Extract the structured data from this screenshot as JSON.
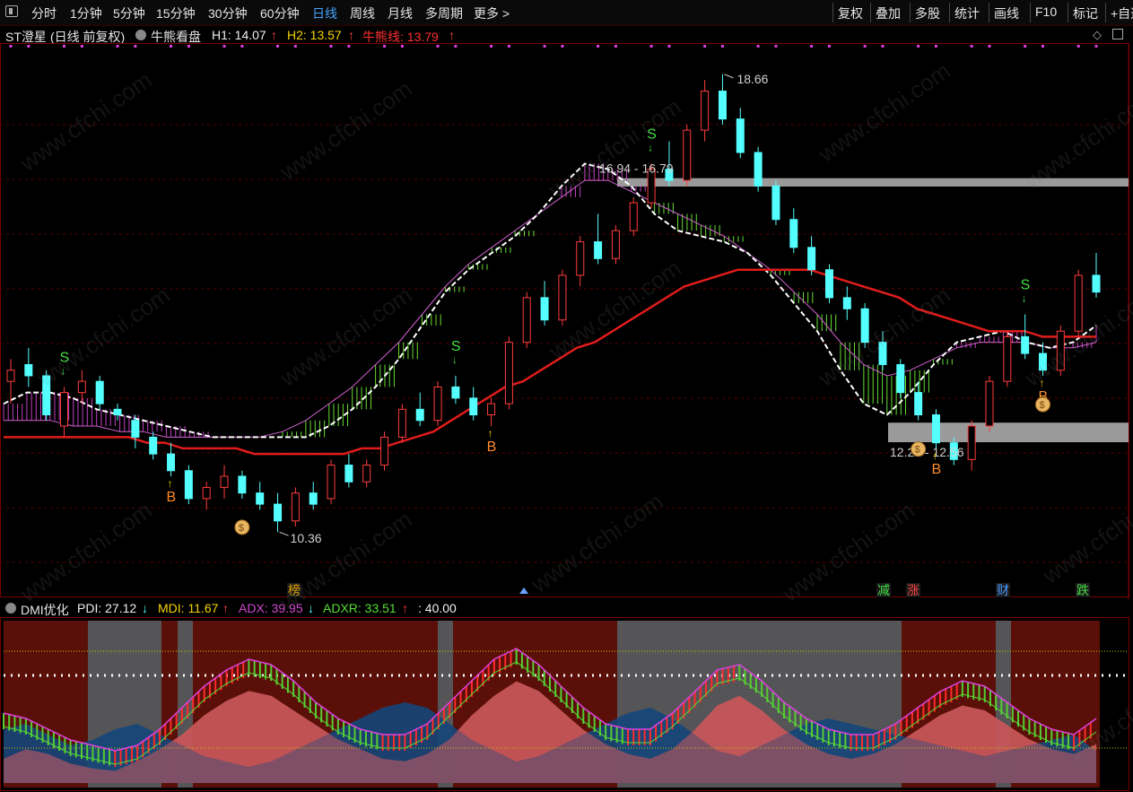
{
  "toolbar": {
    "left": [
      "分时",
      "1分钟",
      "5分钟",
      "15分钟",
      "30分钟",
      "60分钟",
      "日线",
      "周线",
      "月线",
      "多周期",
      "更多 >"
    ],
    "active": "日线",
    "right": [
      "复权",
      "叠加",
      "多股",
      "统计",
      "画线",
      "F10",
      "标记",
      "+自选"
    ]
  },
  "info": {
    "stock": "ST澄星",
    "mode": "(日线 前复权)",
    "indicator": "牛熊看盘",
    "h1_label": "H1: 14.07",
    "h2_label": "H2: 13.57",
    "bear_label": "牛熊线: 13.79",
    "up_arrow": "↑"
  },
  "labels": {
    "high": "18.66",
    "low": "10.36",
    "zone_top": "16.94 - 16.79",
    "zone_bottom": "12.21 - 12.56"
  },
  "events": [
    "榜",
    "减",
    "涨",
    "财",
    "跌"
  ],
  "dmi": {
    "name": "DMI优化",
    "pdi": "PDI: 27.12",
    "mdi": "MDI: 11.67",
    "adx": "ADX: 39.95",
    "adxr": "ADXR: 33.51",
    "level": ": 40.00",
    "down": "↓",
    "up": "↑"
  },
  "watermark": "www.cfchi.com",
  "colors": {
    "up": "#ff3c3c",
    "down": "#54ffff",
    "ma": "#e01c1c",
    "bull_band": "#c040c0",
    "bear_band": "#66dd33",
    "zone": "#9a9a9a",
    "active_tab": "#46a5ff"
  },
  "chart_data": {
    "type": "candlestick",
    "ylim": [
      9.8,
      19.2
    ],
    "candles": [
      [
        13.3,
        13.7,
        12.9,
        13.5
      ],
      [
        13.6,
        13.9,
        13.2,
        13.4
      ],
      [
        13.4,
        13.5,
        12.6,
        12.7
      ],
      [
        12.5,
        13.2,
        12.3,
        13.1
      ],
      [
        13.1,
        13.5,
        12.9,
        13.3
      ],
      [
        13.3,
        13.4,
        12.8,
        12.9
      ],
      [
        12.8,
        12.9,
        12.6,
        12.7
      ],
      [
        12.6,
        12.7,
        12.1,
        12.3
      ],
      [
        12.3,
        12.4,
        11.9,
        12.0
      ],
      [
        12.0,
        12.2,
        11.6,
        11.7
      ],
      [
        11.7,
        11.8,
        11.1,
        11.2
      ],
      [
        11.2,
        11.5,
        11.0,
        11.4
      ],
      [
        11.4,
        11.8,
        11.2,
        11.6
      ],
      [
        11.6,
        11.7,
        11.2,
        11.3
      ],
      [
        11.3,
        11.5,
        11.0,
        11.1
      ],
      [
        11.1,
        11.3,
        10.6,
        10.8
      ],
      [
        10.8,
        11.4,
        10.7,
        11.3
      ],
      [
        11.3,
        11.5,
        11.0,
        11.1
      ],
      [
        11.2,
        11.9,
        11.1,
        11.8
      ],
      [
        11.8,
        12.0,
        11.4,
        11.5
      ],
      [
        11.5,
        11.9,
        11.4,
        11.8
      ],
      [
        11.8,
        12.4,
        11.7,
        12.3
      ],
      [
        12.3,
        12.9,
        12.2,
        12.8
      ],
      [
        12.8,
        13.1,
        12.5,
        12.6
      ],
      [
        12.6,
        13.3,
        12.5,
        13.2
      ],
      [
        13.2,
        13.4,
        12.9,
        13.0
      ],
      [
        13.0,
        13.2,
        12.6,
        12.7
      ],
      [
        12.7,
        13.0,
        12.5,
        12.9
      ],
      [
        12.9,
        14.1,
        12.8,
        14.0
      ],
      [
        14.0,
        14.9,
        13.9,
        14.8
      ],
      [
        14.8,
        15.1,
        14.3,
        14.4
      ],
      [
        14.4,
        15.3,
        14.3,
        15.2
      ],
      [
        15.2,
        15.9,
        15.0,
        15.8
      ],
      [
        15.8,
        16.3,
        15.4,
        15.5
      ],
      [
        15.5,
        16.1,
        15.4,
        16.0
      ],
      [
        16.0,
        16.6,
        15.9,
        16.5
      ],
      [
        16.5,
        17.2,
        16.4,
        17.1
      ],
      [
        17.1,
        17.6,
        16.8,
        16.9
      ],
      [
        16.9,
        17.9,
        16.8,
        17.8
      ],
      [
        17.8,
        18.7,
        17.6,
        18.5
      ],
      [
        18.5,
        18.8,
        17.9,
        18.0
      ],
      [
        18.0,
        18.2,
        17.3,
        17.4
      ],
      [
        17.4,
        17.5,
        16.7,
        16.8
      ],
      [
        16.8,
        16.9,
        16.1,
        16.2
      ],
      [
        16.2,
        16.4,
        15.6,
        15.7
      ],
      [
        15.7,
        15.9,
        15.2,
        15.3
      ],
      [
        15.3,
        15.4,
        14.7,
        14.8
      ],
      [
        14.8,
        15.0,
        14.4,
        14.6
      ],
      [
        14.6,
        14.7,
        13.9,
        14.0
      ],
      [
        14.0,
        14.2,
        13.5,
        13.6
      ],
      [
        13.6,
        13.7,
        13.0,
        13.1
      ],
      [
        13.1,
        13.3,
        12.6,
        12.7
      ],
      [
        12.7,
        12.8,
        12.1,
        12.2
      ],
      [
        12.2,
        12.3,
        11.8,
        11.9
      ],
      [
        11.9,
        12.6,
        11.7,
        12.5
      ],
      [
        12.5,
        13.4,
        12.4,
        13.3
      ],
      [
        13.3,
        14.2,
        13.2,
        14.1
      ],
      [
        14.1,
        14.5,
        13.7,
        13.8
      ],
      [
        13.8,
        14.0,
        13.4,
        13.5
      ],
      [
        13.5,
        14.3,
        13.4,
        14.2
      ],
      [
        14.2,
        15.3,
        14.1,
        15.2
      ],
      [
        15.2,
        15.6,
        14.8,
        14.9
      ]
    ],
    "ma_line": [
      12.3,
      12.3,
      12.3,
      12.3,
      12.3,
      12.3,
      12.3,
      12.3,
      12.2,
      12.2,
      12.1,
      12.1,
      12.1,
      12.1,
      12.0,
      12.0,
      12.0,
      12.0,
      12.0,
      12.0,
      12.1,
      12.1,
      12.2,
      12.3,
      12.4,
      12.6,
      12.8,
      13.0,
      13.2,
      13.3,
      13.5,
      13.7,
      13.9,
      14.0,
      14.2,
      14.4,
      14.6,
      14.8,
      15.0,
      15.1,
      15.2,
      15.3,
      15.3,
      15.3,
      15.3,
      15.3,
      15.2,
      15.1,
      15.0,
      14.9,
      14.8,
      14.6,
      14.5,
      14.4,
      14.3,
      14.2,
      14.2,
      14.2,
      14.1,
      14.1,
      14.1,
      14.1
    ],
    "band_fast": [
      12.9,
      13.1,
      13.1,
      13.0,
      12.8,
      12.7,
      12.6,
      12.5,
      12.4,
      12.3,
      12.3,
      12.3,
      12.3,
      12.3,
      12.5,
      12.8,
      13.2,
      13.7,
      14.3,
      14.9,
      15.3,
      15.6,
      15.9,
      16.3,
      16.8,
      17.2,
      17.1,
      16.8,
      16.3,
      16.0,
      15.9,
      15.8,
      15.6,
      15.2,
      14.7,
      14.2,
      13.5,
      12.9,
      12.7,
      13.1,
      13.6,
      14.0,
      14.1,
      14.2,
      14.0,
      13.9,
      14.0,
      14.3
    ],
    "band_slow": [
      12.6,
      12.6,
      12.6,
      12.5,
      12.5,
      12.4,
      12.4,
      12.3,
      12.3,
      12.3,
      12.3,
      12.3,
      12.4,
      12.6,
      12.9,
      13.2,
      13.6,
      14.0,
      14.5,
      15.0,
      15.4,
      15.7,
      16.0,
      16.3,
      16.6,
      16.9,
      16.9,
      16.7,
      16.5,
      16.3,
      16.1,
      15.9,
      15.6,
      15.3,
      14.9,
      14.5,
      14.0,
      13.6,
      13.4,
      13.5,
      13.7,
      13.9,
      14.0,
      14.0,
      14.0,
      13.9,
      13.9,
      14.0
    ],
    "zones": [
      {
        "label": "16.94 - 16.79",
        "top": 16.94,
        "bottom": 16.79
      },
      {
        "label": "12.21 - 12.56",
        "top": 12.56,
        "bottom": 12.21
      }
    ],
    "dmi": {
      "pdi": [
        10,
        14,
        12,
        8,
        6,
        5,
        9,
        14,
        20,
        28,
        34,
        38,
        36,
        30,
        24,
        18,
        14,
        10,
        9,
        12,
        18,
        28,
        36,
        42,
        38,
        30,
        22,
        16,
        12,
        10,
        14,
        22,
        32,
        36,
        30,
        22,
        16,
        12,
        10,
        12,
        16,
        22,
        28,
        32,
        30,
        24,
        18,
        14,
        12,
        16
      ],
      "mdi": [
        20,
        22,
        18,
        14,
        16,
        20,
        22,
        18,
        14,
        10,
        8,
        6,
        8,
        12,
        16,
        20,
        24,
        28,
        30,
        28,
        22,
        16,
        12,
        8,
        10,
        14,
        18,
        22,
        26,
        28,
        24,
        18,
        12,
        10,
        14,
        18,
        22,
        24,
        22,
        20,
        18,
        16,
        14,
        12,
        10,
        12,
        14,
        16,
        18,
        12
      ],
      "adx": [
        26,
        24,
        20,
        16,
        14,
        12,
        14,
        20,
        28,
        36,
        42,
        46,
        44,
        38,
        30,
        24,
        20,
        18,
        18,
        22,
        30,
        38,
        46,
        50,
        44,
        36,
        28,
        22,
        20,
        20,
        26,
        34,
        42,
        44,
        38,
        30,
        24,
        20,
        18,
        18,
        22,
        28,
        34,
        38,
        36,
        30,
        24,
        20,
        18,
        24
      ],
      "level": 40.0
    }
  }
}
